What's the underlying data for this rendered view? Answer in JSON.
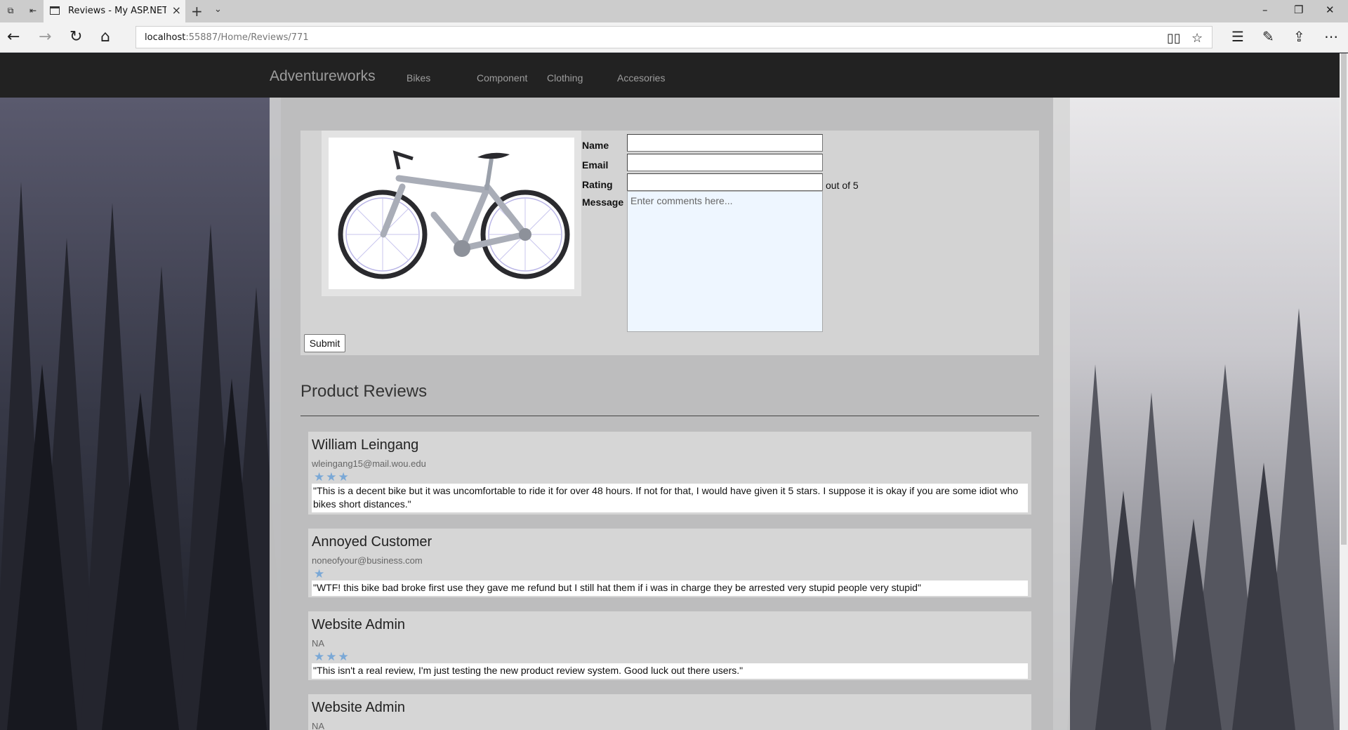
{
  "browser": {
    "tab_title": "Reviews - My ASP.NET A",
    "url_host": "localhost",
    "url_rest": ":55887/Home/Reviews/771"
  },
  "site": {
    "brand": "Adventureworks",
    "nav": [
      "Bikes",
      "Component",
      "Clothing",
      "Accesories"
    ]
  },
  "form": {
    "name_label": "Name",
    "email_label": "Email",
    "rating_label": "Rating",
    "rating_suffix": "out of 5",
    "message_label": "Message",
    "message_placeholder": "Enter comments here...",
    "submit_label": "Submit"
  },
  "reviews_section": {
    "title": "Product Reviews",
    "star_color": "#7aa8d6",
    "items": [
      {
        "name": "William Leingang",
        "email": "wleingang15@mail.wou.edu",
        "rating": 3,
        "stars": "★★★",
        "message": "\"This is a decent bike but it was uncomfortable to ride it for over 48 hours. If not for that, I would have given it 5 stars. I suppose it is okay if you are some idiot who bikes short distances.\""
      },
      {
        "name": "Annoyed Customer",
        "email": "noneofyour@business.com",
        "rating": 1,
        "stars": "★",
        "message": "\"WTF! this bike bad broke first use they gave me refund but I still hat them if i was in charge they be arrested very stupid people very stupid\""
      },
      {
        "name": "Website Admin",
        "email": "NA",
        "rating": 3,
        "stars": "★★★",
        "message": "\"This isn't a real review, I'm just testing the new product review system. Good luck out there users.\""
      },
      {
        "name": "Website Admin",
        "email": "NA"
      }
    ]
  }
}
